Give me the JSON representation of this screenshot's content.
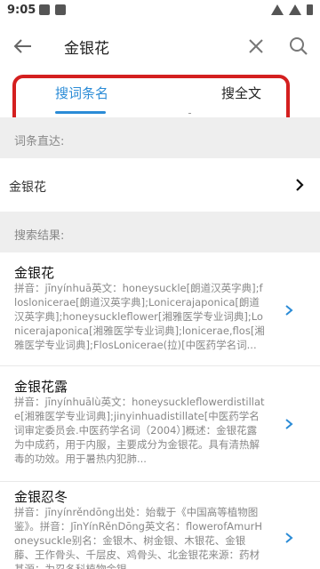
{
  "status_bar": {
    "time": "9:05"
  },
  "search": {
    "query": "金银花"
  },
  "tabs": [
    {
      "label": "搜词条名",
      "active": true
    },
    {
      "label": "搜全文",
      "active": false
    }
  ],
  "direct": {
    "header": "词条直达:",
    "item_label": "金银花"
  },
  "results": {
    "header": "搜索结果:",
    "items": [
      {
        "title": "金银花",
        "body": "拼音：jīnyínhuā英文：honeysuckle[朗道汉英字典];floslonicerae[朗道汉英字典];Lonicerajaponica[朗道汉英字典];honeysuckleflower[湘雅医学专业词典];Lonicerajaponica[湘雅医学专业词典];lonicerae,flos[湘雅医学专业词典];FlosLonicerae(拉)[中医药学名词..."
      },
      {
        "title": "金银花露",
        "body": "拼音：jīnyínhuālù英文：honeysuckleflowerdistillate[湘雅医学专业词典];jinyinhuadistillate[中医药学名词审定委员会.中医药学名词（2004）]概述：金银花露为中成药，用于内服，主要成分为金银花。具有清热解毒的功效。用于暑热内犯肺..."
      },
      {
        "title": "金银忍冬",
        "body": "拼音：jīnyínrěndōng出处：始载于《中国高等植物图鉴》。拼音：JīnYínRěnDōng英文名：flowerofAmurHoneysuckle别名：金银木、树金银、木银花、金银藤、王作骨头、千层皮、鸡骨头、北金银花来源：药材基源：为忍冬科植物金银..."
      }
    ]
  },
  "colors": {
    "accent": "#2a8bd6",
    "highlight": "#d41f1f"
  }
}
